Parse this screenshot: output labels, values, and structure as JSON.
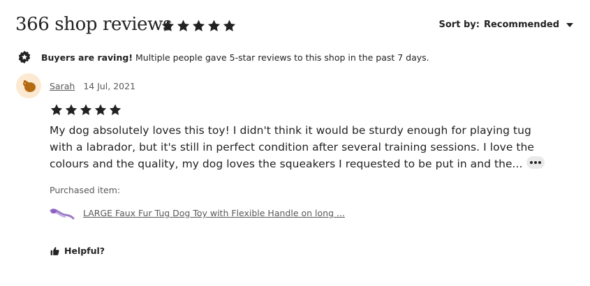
{
  "header": {
    "title": "366 shop reviews",
    "rating": 5,
    "sort_label": "Sort by:",
    "sort_value": "Recommended",
    "star_icon": "star-icon",
    "caret_icon": "caret-down-icon"
  },
  "notice": {
    "icon": "star-badge-icon",
    "bold_text": "Buyers are raving!",
    "text": "Multiple people gave 5-star reviews to this shop in the past 7 days."
  },
  "review": {
    "avatar_icon": "squirrel-avatar-icon",
    "reviewer": "Sarah",
    "date": "14 Jul, 2021",
    "rating": 5,
    "text_lines": [
      "My dog absolutely loves this toy! I didn't think it would be sturdy enough for playing tug",
      "with a labrador, but it's still in perfect condition after several training sessions. I love the",
      "colours and the quality, my dog loves the squeakers I requested to be put in and the..."
    ],
    "more_icon": "more-options-icon",
    "purchased_label": "Purchased item:",
    "item_title": "LARGE Faux Fur Tug Dog Toy with Flexible Handle on long ...",
    "helpful_label": "Helpful?",
    "helpful_icon": "thumbs-up-icon"
  },
  "colors": {
    "text": "#222222",
    "muted": "#595959",
    "avatar_bg": "#fde9d2",
    "avatar_fg": "#b56a12",
    "more_bg": "#e9e9e9"
  }
}
